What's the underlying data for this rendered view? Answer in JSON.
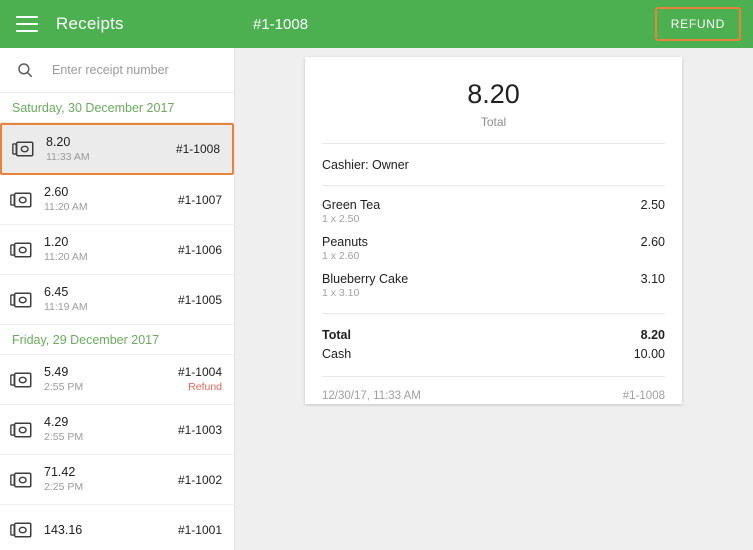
{
  "topbar": {
    "menu_icon": "hamburger-menu-icon",
    "app_title": "Receipts",
    "detail_title": "#1-1008",
    "refund_label": "REFUND",
    "bar_color": "#4CAF50",
    "highlight_color": "#E8833A"
  },
  "search": {
    "icon": "search-icon",
    "value": "",
    "placeholder": "Enter receipt number"
  },
  "groups": [
    {
      "date_label": "Saturday, 30 December 2017",
      "receipts": [
        {
          "icon": "banknote-icon",
          "amount": "8.20",
          "time": "11:33 AM",
          "number": "#1-1008",
          "status": "",
          "selected": true
        },
        {
          "icon": "banknote-icon",
          "amount": "2.60",
          "time": "11:20 AM",
          "number": "#1-1007",
          "status": "",
          "selected": false
        },
        {
          "icon": "banknote-icon",
          "amount": "1.20",
          "time": "11:20 AM",
          "number": "#1-1006",
          "status": "",
          "selected": false
        },
        {
          "icon": "banknote-icon",
          "amount": "6.45",
          "time": "11:19 AM",
          "number": "#1-1005",
          "status": "",
          "selected": false
        }
      ]
    },
    {
      "date_label": "Friday, 29 December 2017",
      "receipts": [
        {
          "icon": "banknote-icon",
          "amount": "5.49",
          "time": "2:55 PM",
          "number": "#1-1004",
          "status": "Refund",
          "selected": false
        },
        {
          "icon": "banknote-icon",
          "amount": "4.29",
          "time": "2:55 PM",
          "number": "#1-1003",
          "status": "",
          "selected": false
        },
        {
          "icon": "banknote-icon",
          "amount": "71.42",
          "time": "2:25 PM",
          "number": "#1-1002",
          "status": "",
          "selected": false
        },
        {
          "icon": "banknote-icon",
          "amount": "143.16",
          "time": "",
          "number": "#1-1001",
          "status": "",
          "selected": false
        }
      ]
    }
  ],
  "receipt_card": {
    "total_amount": "8.20",
    "total_label": "Total",
    "cashier": "Cashier: Owner",
    "items": [
      {
        "name": "Green Tea",
        "price": "2.50",
        "qty": "1 x 2.50"
      },
      {
        "name": "Peanuts",
        "price": "2.60",
        "qty": "1 x 2.60"
      },
      {
        "name": "Blueberry Cake",
        "price": "3.10",
        "qty": "1 x 3.10"
      }
    ],
    "summary": [
      {
        "label": "Total",
        "value": "8.20",
        "bold": true
      },
      {
        "label": "Cash",
        "value": "10.00",
        "bold": false
      }
    ],
    "footer_datetime": "12/30/17, 11:33 AM",
    "footer_number": "#1-1008"
  },
  "colors": {
    "accent_green": "#4CAF50",
    "date_green": "#6aab5e",
    "highlight_orange": "#E8833A",
    "refund_red": "#E8645A",
    "page_bg": "#efefef"
  }
}
